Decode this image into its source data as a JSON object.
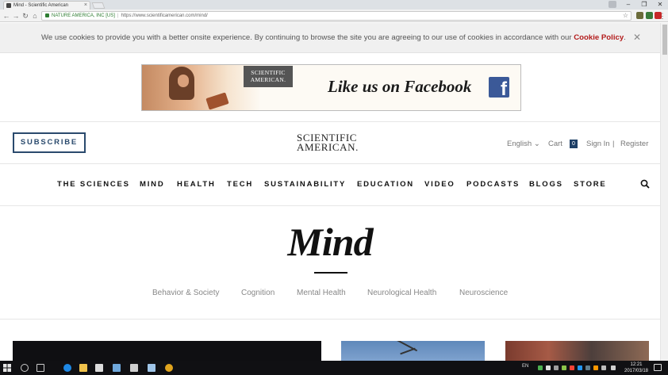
{
  "browser": {
    "tab_title": "Mind - Scientific American",
    "tab_close": "×",
    "security_label": "NATURE AMERICA, INC [US]",
    "separator": "|",
    "url": "https://www.scientificamerican.com/mind/",
    "back_icon": "←",
    "forward_icon": "→",
    "reload_icon": "↻",
    "home_icon": "⌂",
    "bookmark_icon": "☆",
    "minimize": "–",
    "maximize": "❐",
    "close": "✕",
    "menu_icon": "⋮"
  },
  "cookie": {
    "text": "We use cookies to provide you with a better onsite experience. By continuing to browse the site you are agreeing to our use of cookies in accordance with our ",
    "link": "Cookie Policy",
    "suffix": ".",
    "close": "✕"
  },
  "ad": {
    "logo_line1": "SCIENTIFIC",
    "logo_line2": "AMERICAN.",
    "text": "Like us on Facebook",
    "fb_letter": "f",
    "brand_color": "#3b5998"
  },
  "header": {
    "subscribe": "SUBSCRIBE",
    "logo_line1": "SCIENTIFIC",
    "logo_line2": "AMERICAN.",
    "language": "English",
    "language_caret": "⌄",
    "cart": "Cart",
    "cart_count": "0",
    "sign_in": "Sign In",
    "divider": "|",
    "register": "Register"
  },
  "nav": {
    "items": [
      "THE SCIENCES",
      "MIND",
      "HEALTH",
      "TECH",
      "SUSTAINABILITY",
      "EDUCATION",
      "VIDEO",
      "PODCASTS",
      "BLOGS",
      "STORE"
    ]
  },
  "hero": {
    "title": "Mind",
    "subcategories": [
      "Behavior & Society",
      "Cognition",
      "Mental Health",
      "Neurological Health",
      "Neuroscience"
    ]
  },
  "taskbar": {
    "language": "EN",
    "time": "12:21",
    "date": "2017/03/18"
  }
}
